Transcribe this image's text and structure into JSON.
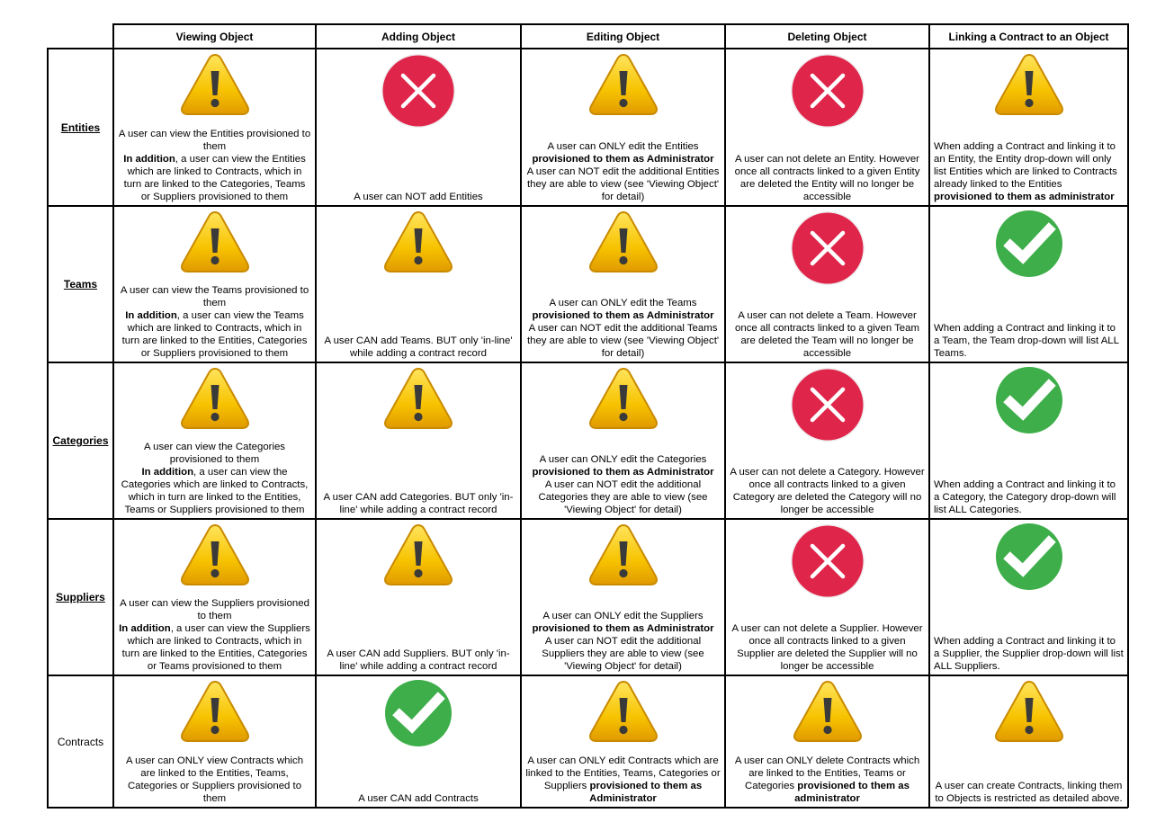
{
  "columns": [
    "Viewing Object",
    "Adding Object",
    "Editing Object",
    "Deleting Object",
    "Linking a Contract to an Object"
  ],
  "icon_colors": {
    "warning": "#F4B400",
    "deny": "#E0254A",
    "allow": "#3DAE49"
  },
  "rows": [
    {
      "label": "Entities",
      "cells": [
        {
          "icon": "warning-icon",
          "lines": [
            {
              "text": "A user can view the Entities provisioned to them"
            },
            {
              "bold": "In addition",
              "text": ", a user can view the Entities which are linked to Contracts, which in turn are linked to the Categories, Teams or Suppliers provisioned to them"
            }
          ]
        },
        {
          "icon": "deny-icon",
          "lines": [
            {
              "text": "A user can NOT add Entities"
            }
          ]
        },
        {
          "icon": "warning-icon",
          "lines": [
            {
              "text": "A user can ONLY edit the Entities"
            },
            {
              "bold": "provisioned to them as Administrator"
            },
            {
              "text": "A user can NOT edit the additional Entities they are able to view (see 'Viewing Object' for detail)"
            }
          ]
        },
        {
          "icon": "deny-icon",
          "lines": [
            {
              "text": "A user can not delete an Entity. However once all contracts linked to a given Entity are deleted the Entity will no longer be accessible"
            }
          ]
        },
        {
          "icon": "warning-icon",
          "align": "left",
          "lines": [
            {
              "text": "When adding a Contract and linking it to an Entity, the Entity drop-down will only list Entities which are linked to Contracts already linked to the Entities"
            },
            {
              "bold": "provisioned to them as administrator"
            }
          ]
        }
      ]
    },
    {
      "label": "Teams",
      "cells": [
        {
          "icon": "warning-icon",
          "lines": [
            {
              "text": "A user can view the Teams provisioned to them"
            },
            {
              "bold": "In addition",
              "text": ", a user can view the Teams which are linked to Contracts, which in turn are linked to the Entities, Categories or Suppliers provisioned to them"
            }
          ]
        },
        {
          "icon": "warning-icon",
          "lines": [
            {
              "text": "A user CAN add Teams. BUT only 'in-line' while adding a contract record"
            }
          ]
        },
        {
          "icon": "warning-icon",
          "lines": [
            {
              "text": "A user can ONLY edit the Teams"
            },
            {
              "bold": "provisioned to them as Administrator"
            },
            {
              "text": "A user can NOT edit the additional Teams they are able to view (see 'Viewing Object' for detail)"
            }
          ]
        },
        {
          "icon": "deny-icon",
          "lines": [
            {
              "text": "A user can not delete a Team. However once all contracts linked to a given Team are deleted the Team will no longer be accessible"
            }
          ]
        },
        {
          "icon": "allow-icon",
          "align": "left",
          "lines": [
            {
              "text": "When adding a Contract and linking it to a Team, the Team drop-down will list ALL Teams."
            }
          ]
        }
      ]
    },
    {
      "label": "Categories",
      "cells": [
        {
          "icon": "warning-icon",
          "lines": [
            {
              "text": "A user can view the Categories provisioned to them"
            },
            {
              "bold": "In addition",
              "text": ", a user can view the Categories which are linked to Contracts, which in turn are linked to the Entities, Teams or Suppliers provisioned to them"
            }
          ]
        },
        {
          "icon": "warning-icon",
          "lines": [
            {
              "text": "A user CAN add Categories. BUT only 'in-line' while adding a contract record"
            }
          ]
        },
        {
          "icon": "warning-icon",
          "lines": [
            {
              "text": "A user can ONLY edit the Categories"
            },
            {
              "bold": "provisioned to them as Administrator"
            },
            {
              "text": "A user can NOT edit the additional Categories they are able to view (see 'Viewing Object' for detail)"
            }
          ]
        },
        {
          "icon": "deny-icon",
          "lines": [
            {
              "text": "A user can not delete a Category. However once all contracts linked to a given Category are deleted the Category will no longer be accessible"
            }
          ]
        },
        {
          "icon": "allow-icon",
          "align": "left",
          "lines": [
            {
              "text": "When adding a Contract and linking it to a Category, the Category drop-down will list ALL Categories."
            }
          ]
        }
      ]
    },
    {
      "label": "Suppliers",
      "cells": [
        {
          "icon": "warning-icon",
          "lines": [
            {
              "text": "A user can view the Suppliers provisioned to them"
            },
            {
              "bold": "In addition",
              "text": ", a user can view the Suppliers which are linked to Contracts, which in turn are linked to the Entities, Categories or Teams provisioned to them"
            }
          ]
        },
        {
          "icon": "warning-icon",
          "lines": [
            {
              "text": "A user CAN add Suppliers. BUT only 'in-line' while adding a contract record"
            }
          ]
        },
        {
          "icon": "warning-icon",
          "lines": [
            {
              "text": "A user can ONLY edit the Suppliers"
            },
            {
              "bold": "provisioned to them as Administrator"
            },
            {
              "text": "A user can NOT edit the additional Suppliers they are able to view (see 'Viewing Object' for detail)"
            }
          ]
        },
        {
          "icon": "deny-icon",
          "lines": [
            {
              "text": "A user can not delete a Supplier. However once all contracts linked to a given Supplier are deleted the Supplier will no longer be accessible"
            }
          ]
        },
        {
          "icon": "allow-icon",
          "align": "left",
          "lines": [
            {
              "text": "When adding a Contract and linking it to a Supplier, the Supplier drop-down will list ALL Suppliers."
            }
          ]
        }
      ]
    },
    {
      "label": "Contracts",
      "plain_label": true,
      "cells": [
        {
          "icon": "warning-icon",
          "lines": [
            {
              "text": "A user can ONLY view Contracts which are linked to the Entities, Teams, Categories or Suppliers provisioned to them"
            }
          ]
        },
        {
          "icon": "allow-icon",
          "lines": [
            {
              "text": "A user CAN add Contracts"
            }
          ]
        },
        {
          "icon": "warning-icon",
          "lines": [
            {
              "text": "A user can ONLY edit Contracts which are linked to the Entities, Teams, Categories or Suppliers ",
              "bold_after": "provisioned to them as Administrator"
            }
          ]
        },
        {
          "icon": "warning-icon",
          "lines": [
            {
              "text": "A user can ONLY delete Contracts which are linked to the Entities, Teams or Categories ",
              "bold_after": "provisioned to them as administrator"
            }
          ]
        },
        {
          "icon": "warning-icon",
          "lines": [
            {
              "text": "A user can create Contracts, linking them to Objects is restricted as detailed above."
            }
          ]
        }
      ]
    }
  ]
}
